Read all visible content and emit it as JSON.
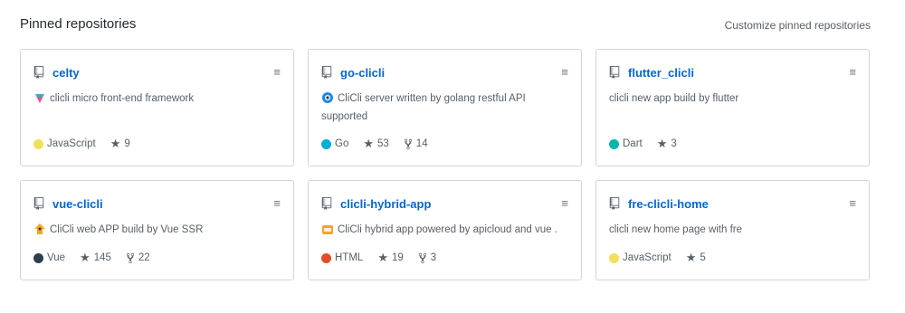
{
  "header": {
    "title": "Pinned repositories",
    "customize_label": "Customize pinned repositories"
  },
  "repos": [
    {
      "name": "celty",
      "desc_icon": "pink-gem-icon",
      "description": "clicli micro front-end framework",
      "language": "JavaScript",
      "lang_color": "#f1e05a",
      "stars": "9",
      "forks": ""
    },
    {
      "name": "go-clicli",
      "desc_icon": "blue-circle-icon",
      "description": "CliCli server written by golang restful API supported",
      "language": "Go",
      "lang_color": "#00ADD8",
      "stars": "53",
      "forks": "14"
    },
    {
      "name": "flutter_clicli",
      "desc_icon": "",
      "description": "clicli new app build by flutter",
      "language": "Dart",
      "lang_color": "#00B4AB",
      "stars": "3",
      "forks": ""
    },
    {
      "name": "vue-clicli",
      "desc_icon": "orange-character-icon",
      "description": "CliCli web APP build by Vue SSR",
      "language": "Vue",
      "lang_color": "#2c3e50",
      "stars": "145",
      "forks": "22"
    },
    {
      "name": "clicli-hybrid-app",
      "desc_icon": "orange-box-icon",
      "description": "CliCli hybrid app powered by apicloud and vue .",
      "language": "HTML",
      "lang_color": "#e34c26",
      "stars": "19",
      "forks": "3"
    },
    {
      "name": "fre-clicli-home",
      "desc_icon": "",
      "description": "clicli new home page with fre",
      "language": "JavaScript",
      "lang_color": "#f1e05a",
      "stars": "5",
      "forks": ""
    }
  ]
}
